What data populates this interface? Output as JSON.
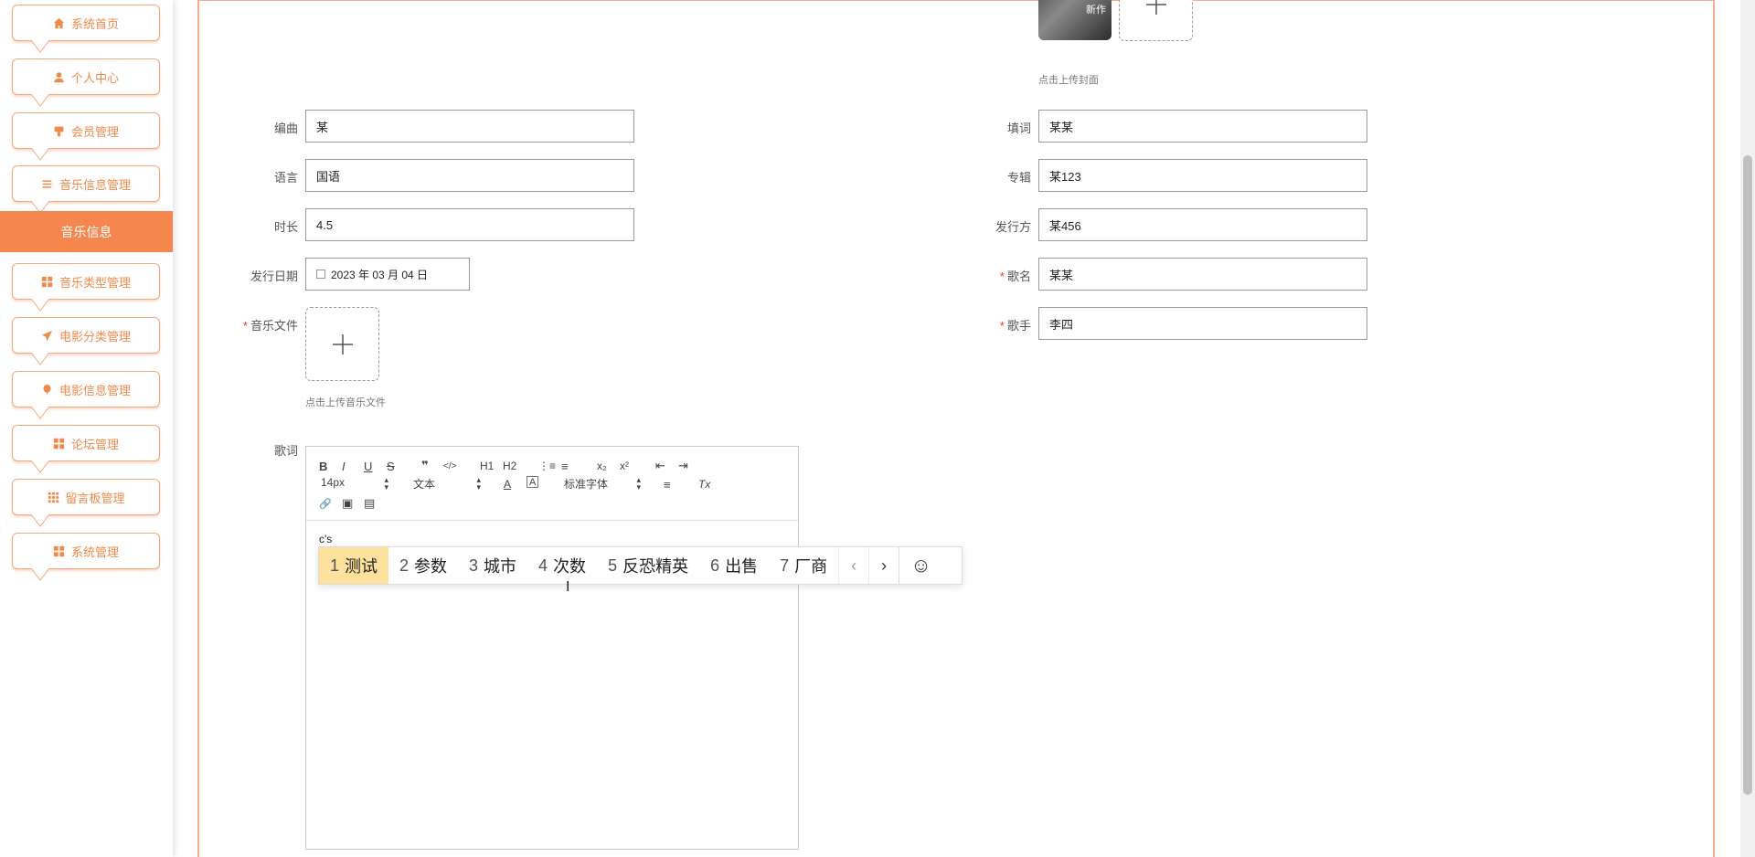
{
  "sidebar": {
    "items": [
      {
        "label": "系统首页",
        "icon": "home-icon"
      },
      {
        "label": "个人中心",
        "icon": "user-icon"
      },
      {
        "label": "会员管理",
        "icon": "member-icon"
      },
      {
        "label": "音乐信息管理",
        "icon": "list-icon"
      },
      {
        "label": "音乐类型管理",
        "icon": "grid-icon"
      },
      {
        "label": "电影分类管理",
        "icon": "send-icon"
      },
      {
        "label": "电影信息管理",
        "icon": "balloon-icon"
      },
      {
        "label": "论坛管理",
        "icon": "grid-icon"
      },
      {
        "label": "留言板管理",
        "icon": "apps-icon"
      },
      {
        "label": "系统管理",
        "icon": "grid-icon"
      }
    ],
    "active": "音乐信息"
  },
  "form": {
    "cover_hint": "点击上传封面",
    "cover_text": "新作",
    "bianqu_label": "编曲",
    "bianqu_value": "某",
    "tianci_label": "填词",
    "tianci_value": "某某",
    "yuyan_label": "语言",
    "yuyan_value": "国语",
    "zhuanji_label": "专辑",
    "zhuanji_value": "某123",
    "shichang_label": "时长",
    "shichang_value": "4.5",
    "faxingfang_label": "发行方",
    "faxingfang_value": "某456",
    "riqi_label": "发行日期",
    "riqi_value": "2023 年 03 月 04 日",
    "geming_label": "歌名",
    "geming_value": "某某",
    "wenjian_label": "音乐文件",
    "wenjian_hint": "点击上传音乐文件",
    "geshou_label": "歌手",
    "geshou_value": "李四",
    "geci_label": "歌词",
    "required_mark": "*"
  },
  "editor": {
    "font_size": "14px",
    "paragraph": "文本",
    "font_family": "标准字体",
    "content": "c's",
    "buttons": {
      "bold": "B",
      "italic": "I",
      "underline": "U",
      "strike": "S",
      "quote": "❞",
      "code": "</>",
      "h1": "H1",
      "h2": "H2",
      "ol": "⋮≡",
      "ul": "≡",
      "sub": "x₂",
      "sup": "x²",
      "outdent": "⇤",
      "indent": "⇥",
      "color": "A",
      "bg": "A",
      "align": "≡",
      "clean": "Tx",
      "link": "🔗",
      "image": "▣",
      "video": "▤"
    }
  },
  "ime": {
    "candidates": [
      {
        "n": "1",
        "t": "测试"
      },
      {
        "n": "2",
        "t": "参数"
      },
      {
        "n": "3",
        "t": "城市"
      },
      {
        "n": "4",
        "t": "次数"
      },
      {
        "n": "5",
        "t": "反恐精英"
      },
      {
        "n": "6",
        "t": "出售"
      },
      {
        "n": "7",
        "t": "厂商"
      }
    ],
    "prev": "‹",
    "next": "›",
    "emoji": "☺"
  },
  "colors": {
    "accent": "#f5874e",
    "border": "#f3a87a",
    "selected": "#fde19c"
  }
}
